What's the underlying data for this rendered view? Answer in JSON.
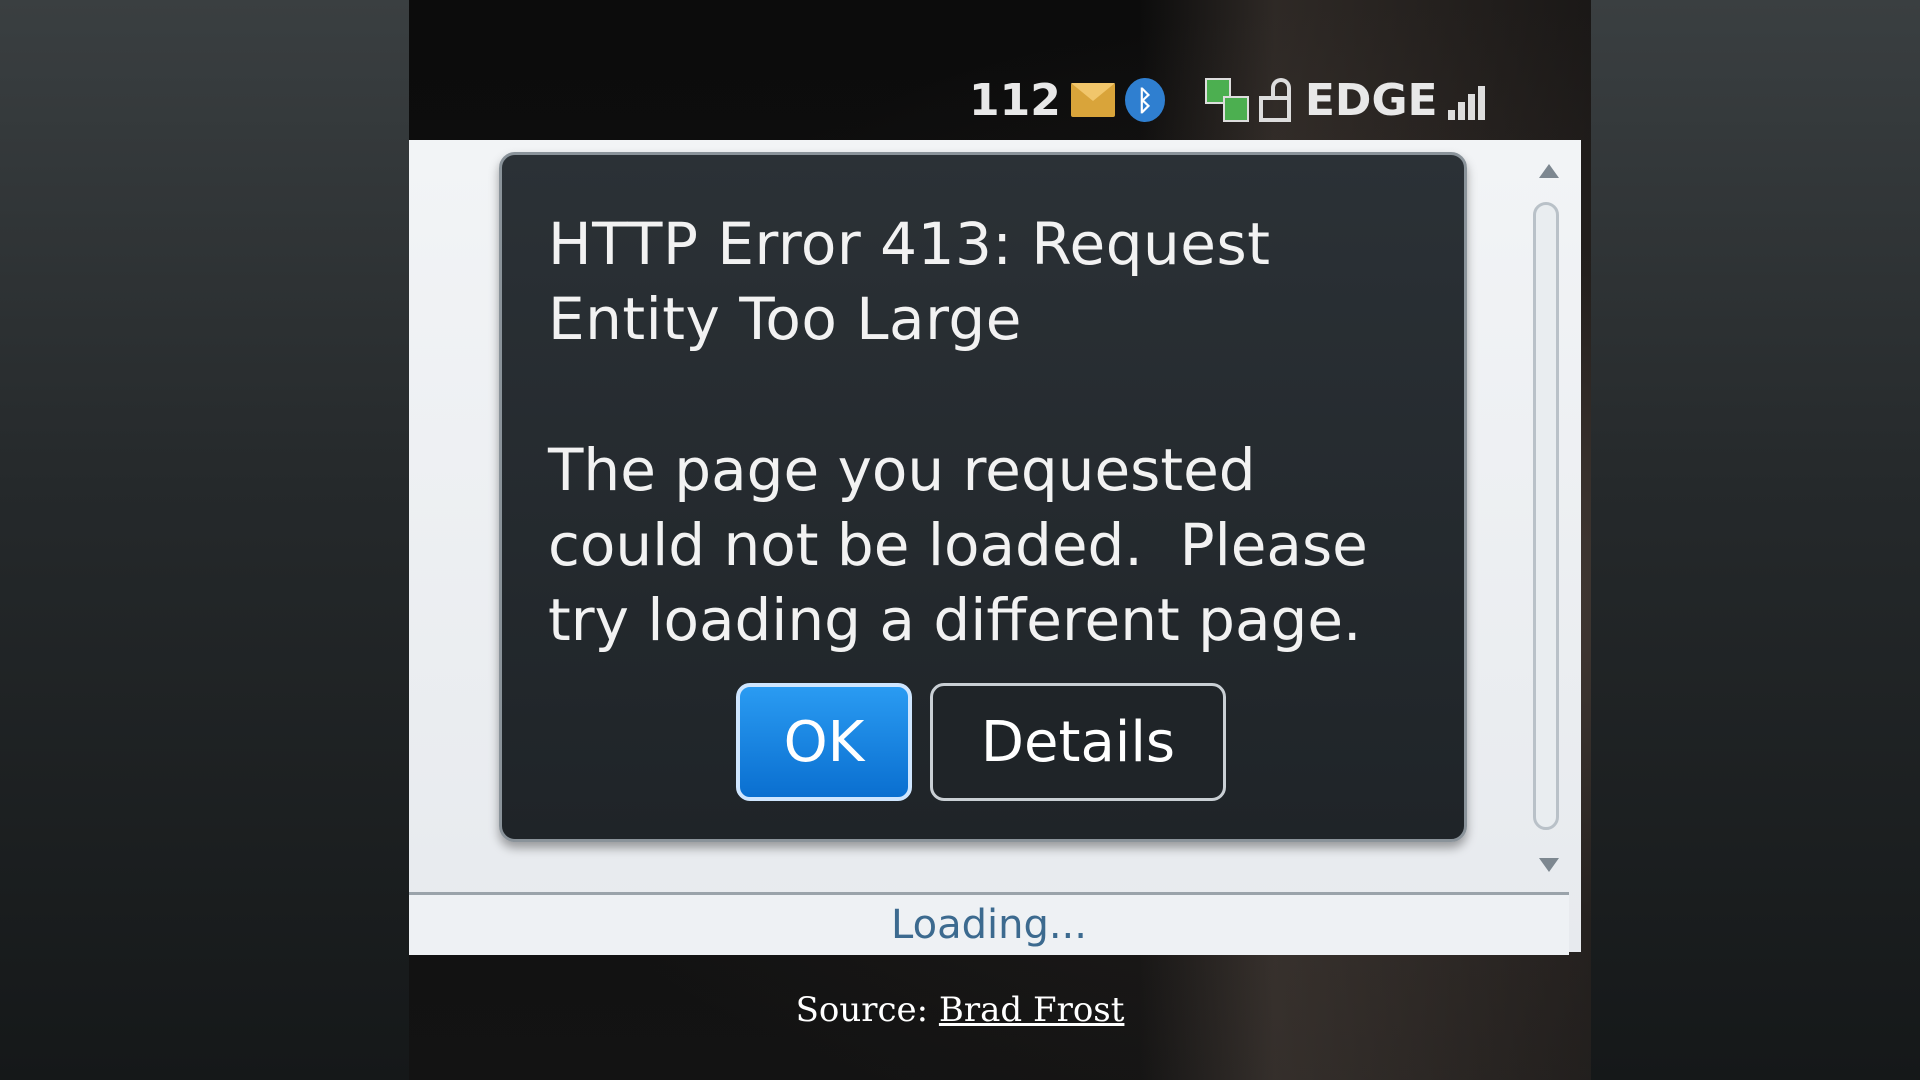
{
  "status_bar": {
    "message_count": "112",
    "network": "EDGE",
    "icons": [
      "mail-icon",
      "bluetooth-icon",
      "data-transfer-icon",
      "unlock-icon",
      "signal-strength-icon"
    ]
  },
  "dialog": {
    "title_line1": "HTTP Error 413: Request",
    "title_line2": "Entity Too Large",
    "message_line1": "The page you requested",
    "message_line2": "could not be loaded.  Please",
    "message_line3": "try loading a different page.",
    "ok_label": "OK",
    "details_label": "Details"
  },
  "loading_text": "Loading...",
  "caption": {
    "prefix": "Source: ",
    "link_text": "Brad Frost"
  },
  "colors": {
    "ok_button": "#0a6fd0",
    "dialog_bg": "#1f2428",
    "loading_text": "#3c6a8f"
  }
}
